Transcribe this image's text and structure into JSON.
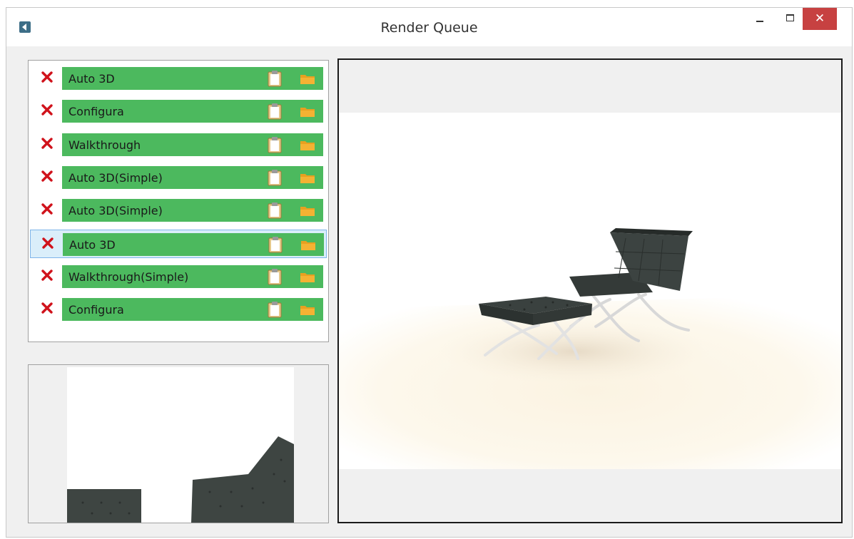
{
  "window": {
    "title": "Render Queue",
    "close_symbol": "✕",
    "icons": {
      "app": "back-arrow-icon",
      "minimize": "minimize-icon",
      "maximize": "maximize-icon",
      "close": "close-icon"
    }
  },
  "queue": {
    "items": [
      {
        "label": "Auto 3D",
        "selected": false
      },
      {
        "label": "Configura",
        "selected": false
      },
      {
        "label": "Walkthrough",
        "selected": false
      },
      {
        "label": "Auto 3D(Simple)",
        "selected": false
      },
      {
        "label": "Auto 3D(Simple)",
        "selected": false
      },
      {
        "label": "Auto 3D",
        "selected": true
      },
      {
        "label": "Walkthrough(Simple)",
        "selected": false
      },
      {
        "label": "Configura",
        "selected": false
      }
    ],
    "item_icons": {
      "remove": "remove-x-icon",
      "log": "clipboard-icon",
      "open_folder": "folder-icon"
    }
  },
  "colors": {
    "item_bar": "#4cb95e",
    "remove_x": "#d0121b",
    "selection_bg": "#daeefa",
    "selection_border": "#7eb4ea",
    "close_button": "#c74141",
    "folder": "#f4b233",
    "clipboard": "#e5c88a"
  }
}
